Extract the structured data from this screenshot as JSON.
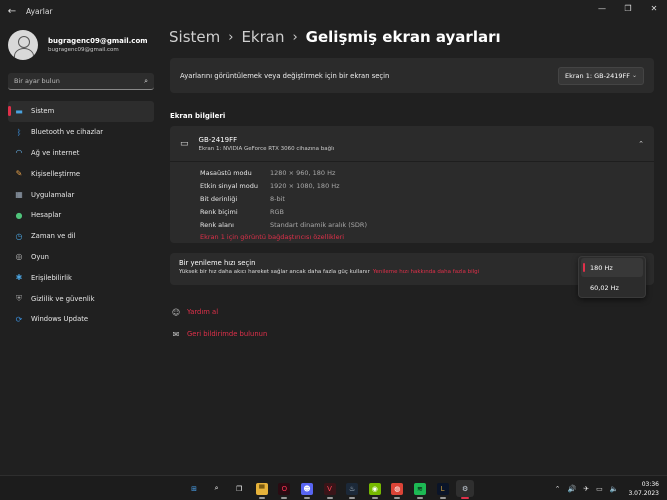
{
  "window": {
    "title": "Ayarlar",
    "back_glyph": "←",
    "minimize": "—",
    "maximize": "❐",
    "close": "✕"
  },
  "profile": {
    "name": "bugragenc09@gmail.com",
    "email": "bugragenc09@gmail.com"
  },
  "search": {
    "placeholder": "Bir ayar bulun",
    "icon": "⌕"
  },
  "nav": [
    {
      "label": "Sistem",
      "icon": "monitor-icon",
      "glyph": "▬",
      "color": "#4aa3df",
      "active": true
    },
    {
      "label": "Bluetooth ve cihazlar",
      "icon": "bluetooth-icon",
      "glyph": "ᛒ",
      "color": "#3b8fdc"
    },
    {
      "label": "Ağ ve internet",
      "icon": "wifi-icon",
      "glyph": "◠",
      "color": "#6bb8f0"
    },
    {
      "label": "Kişiselleştirme",
      "icon": "brush-icon",
      "glyph": "✎",
      "color": "#e8a24a"
    },
    {
      "label": "Uygulamalar",
      "icon": "apps-icon",
      "glyph": "▦",
      "color": "#9aa8b8"
    },
    {
      "label": "Hesaplar",
      "icon": "person-icon",
      "glyph": "●",
      "color": "#4fc37a"
    },
    {
      "label": "Zaman ve dil",
      "icon": "globe-clock-icon",
      "glyph": "◷",
      "color": "#4aa3df"
    },
    {
      "label": "Oyun",
      "icon": "gamepad-icon",
      "glyph": "◎",
      "color": "#bbbbbb"
    },
    {
      "label": "Erişilebilirlik",
      "icon": "accessibility-icon",
      "glyph": "✱",
      "color": "#4aa3df"
    },
    {
      "label": "Gizlilik ve güvenlik",
      "icon": "shield-icon",
      "glyph": "⛨",
      "color": "#9a9a9a"
    },
    {
      "label": "Windows Update",
      "icon": "update-icon",
      "glyph": "⟳",
      "color": "#3b8fdc"
    }
  ],
  "breadcrumb": {
    "part1": "Sistem",
    "part2": "Ekran",
    "current": "Gelişmiş ekran ayarları",
    "sep": "›"
  },
  "selector": {
    "label": "Ayarlarını görüntülemek veya değiştirmek için bir ekran seçin",
    "value": "Ekran 1: GB-2419FF",
    "chevron": "⌄"
  },
  "section_title": "Ekran bilgileri",
  "display": {
    "name": "GB-2419FF",
    "subtitle": "Ekran 1: NVIDIA GeForce RTX 3060 cihazına bağlı",
    "monitor_glyph": "▭",
    "collapse_glyph": "⌃",
    "rows": [
      {
        "key": "Masaüstü modu",
        "value": "1280 × 960, 180 Hz"
      },
      {
        "key": "Etkin sinyal modu",
        "value": "1920 × 1080, 180 Hz"
      },
      {
        "key": "Bit derinliği",
        "value": "8-bit"
      },
      {
        "key": "Renk biçimi",
        "value": "RGB"
      },
      {
        "key": "Renk alanı",
        "value": "Standart dinamik aralık (SDR)"
      }
    ],
    "adapter_link": "Ekran 1 için görüntü bağdaştırıcısı özellikleri"
  },
  "refresh": {
    "title": "Bir yenileme hızı seçin",
    "description": "Yüksek bir hız daha akıcı hareket sağlar ancak daha fazla güç kullanır",
    "link": "Yenileme hızı hakkında daha fazla bilgi",
    "options": [
      "180 Hz",
      "60,02 Hz"
    ]
  },
  "help_links": [
    {
      "label": "Yardım al",
      "glyph": "☺"
    },
    {
      "label": "Geri bildirimde bulunun",
      "glyph": "✉"
    }
  ],
  "taskbar": {
    "apps": [
      {
        "name": "start-icon",
        "glyph": "⊞",
        "bg": "transparent",
        "fg": "#4aa3f0"
      },
      {
        "name": "taskbar-search-icon",
        "glyph": "⌕",
        "bg": "transparent",
        "fg": "#ffffff"
      },
      {
        "name": "task-view-icon",
        "glyph": "❐",
        "bg": "transparent",
        "fg": "#ffffff"
      },
      {
        "name": "file-explorer-icon",
        "glyph": "▀",
        "bg": "#e6b23a",
        "fg": "#7a5a10"
      },
      {
        "name": "opera-gx-icon",
        "glyph": "O",
        "bg": "#2a0b12",
        "fg": "#ff3355"
      },
      {
        "name": "discord-icon",
        "glyph": "☻",
        "bg": "#5865f2",
        "fg": "#ffffff"
      },
      {
        "name": "valorant-icon",
        "glyph": "V",
        "bg": "#3a1418",
        "fg": "#ff4655"
      },
      {
        "name": "steam-icon",
        "glyph": "♨",
        "bg": "#1b2838",
        "fg": "#c7d5e0"
      },
      {
        "name": "nvidia-icon",
        "glyph": "◉",
        "bg": "#76b900",
        "fg": "#ffffff"
      },
      {
        "name": "chrome-icon",
        "glyph": "◍",
        "bg": "#db4437",
        "fg": "#ffffff"
      },
      {
        "name": "spotify-icon",
        "glyph": "≋",
        "bg": "#1db954",
        "fg": "#000000"
      },
      {
        "name": "league-icon",
        "glyph": "L",
        "bg": "#0a1428",
        "fg": "#c89b3c"
      },
      {
        "name": "settings-app-icon",
        "glyph": "⚙",
        "bg": "transparent",
        "fg": "#cfd8e3"
      }
    ],
    "tray": [
      "⌃",
      "🔊",
      "✈",
      "▭",
      "🔈"
    ],
    "time": "03:36",
    "date": "3.07.2023"
  }
}
